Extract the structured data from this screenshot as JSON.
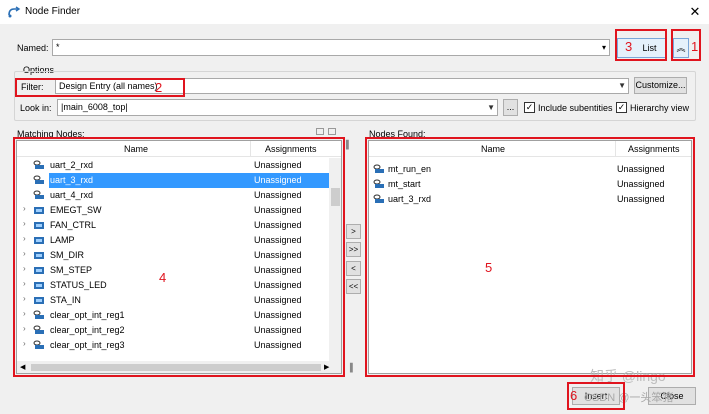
{
  "window": {
    "title": "Node Finder",
    "close": "✕"
  },
  "named": {
    "label": "Named:",
    "value": "*",
    "list_button": "List"
  },
  "options": {
    "group_label": "Options",
    "filter_label": "Filter:",
    "filter_value": "Design Entry (all names)",
    "customize_button": "Customize...",
    "lookin_label": "Look in:",
    "lookin_value": "|main_6008_top|",
    "browse_button": "...",
    "include_subentities": "Include subentities",
    "hierarchy_view": "Hierarchy view",
    "include_subentities_checked": true,
    "hierarchy_view_checked": true
  },
  "matching": {
    "label": "Matching Nodes:",
    "col_name": "Name",
    "col_assign": "Assignments",
    "rows": [
      {
        "name": "uart_2_rxd",
        "assign": "Unassigned",
        "icon": "input-pin-icon",
        "expandable": false
      },
      {
        "name": "uart_3_rxd",
        "assign": "Unassigned",
        "icon": "input-pin-icon",
        "expandable": false,
        "selected": true
      },
      {
        "name": "uart_4_rxd",
        "assign": "Unassigned",
        "icon": "input-pin-icon",
        "expandable": false
      },
      {
        "name": "EMEGT_SW",
        "assign": "Unassigned",
        "icon": "entity-icon",
        "expandable": true
      },
      {
        "name": "FAN_CTRL",
        "assign": "Unassigned",
        "icon": "entity-icon",
        "expandable": true
      },
      {
        "name": "LAMP",
        "assign": "Unassigned",
        "icon": "entity-icon",
        "expandable": true
      },
      {
        "name": "SM_DIR",
        "assign": "Unassigned",
        "icon": "entity-icon",
        "expandable": true
      },
      {
        "name": "SM_STEP",
        "assign": "Unassigned",
        "icon": "entity-icon",
        "expandable": true
      },
      {
        "name": "STATUS_LED",
        "assign": "Unassigned",
        "icon": "entity-icon",
        "expandable": true
      },
      {
        "name": "STA_IN",
        "assign": "Unassigned",
        "icon": "entity-icon",
        "expandable": true
      },
      {
        "name": "clear_opt_int_reg1",
        "assign": "Unassigned",
        "icon": "register-icon",
        "expandable": true
      },
      {
        "name": "clear_opt_int_reg2",
        "assign": "Unassigned",
        "icon": "register-icon",
        "expandable": true
      },
      {
        "name": "clear_opt_int_reg3",
        "assign": "Unassigned",
        "icon": "register-icon",
        "expandable": true
      }
    ]
  },
  "found": {
    "label": "Nodes Found:",
    "col_name": "Name",
    "col_assign": "Assignments",
    "rows": [
      {
        "name": "mt_run_en",
        "assign": "Unassigned"
      },
      {
        "name": "mt_start",
        "assign": "Unassigned"
      },
      {
        "name": "uart_3_rxd",
        "assign": "Unassigned"
      }
    ]
  },
  "transfer": {
    "add": ">",
    "add_all": ">>",
    "remove": "<",
    "remove_all": "<<"
  },
  "footer": {
    "insert_button": "Insert",
    "close_button": "Close"
  },
  "annotations": {
    "n1": "1",
    "n2": "2",
    "n3": "3",
    "n4": "4",
    "n5": "5",
    "n6": "6"
  },
  "watermark": {
    "line1": "知乎 @lingo",
    "line2": "CSDN @一头笨猪"
  },
  "colors": {
    "annotation_red": "#e0141e",
    "selection": "#3399ff"
  }
}
